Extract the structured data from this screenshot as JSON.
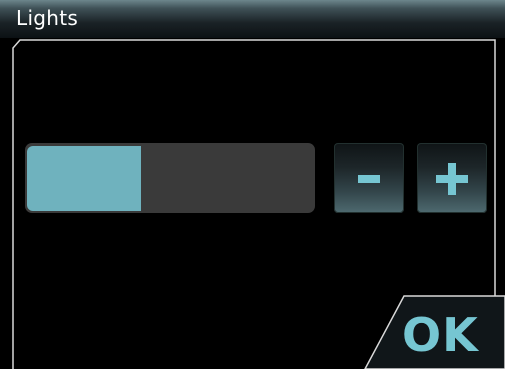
{
  "window": {
    "title": "Lights"
  },
  "brightness": {
    "level": 0.4
  },
  "controls": {
    "decrease_label": "-",
    "increase_label": "+",
    "ok_label": "OK"
  },
  "colors": {
    "accent": "#6fb2be",
    "ok_text": "#76c6d2",
    "track": "#3a3a3a",
    "background": "#000000",
    "border": "#d9d9d9"
  }
}
